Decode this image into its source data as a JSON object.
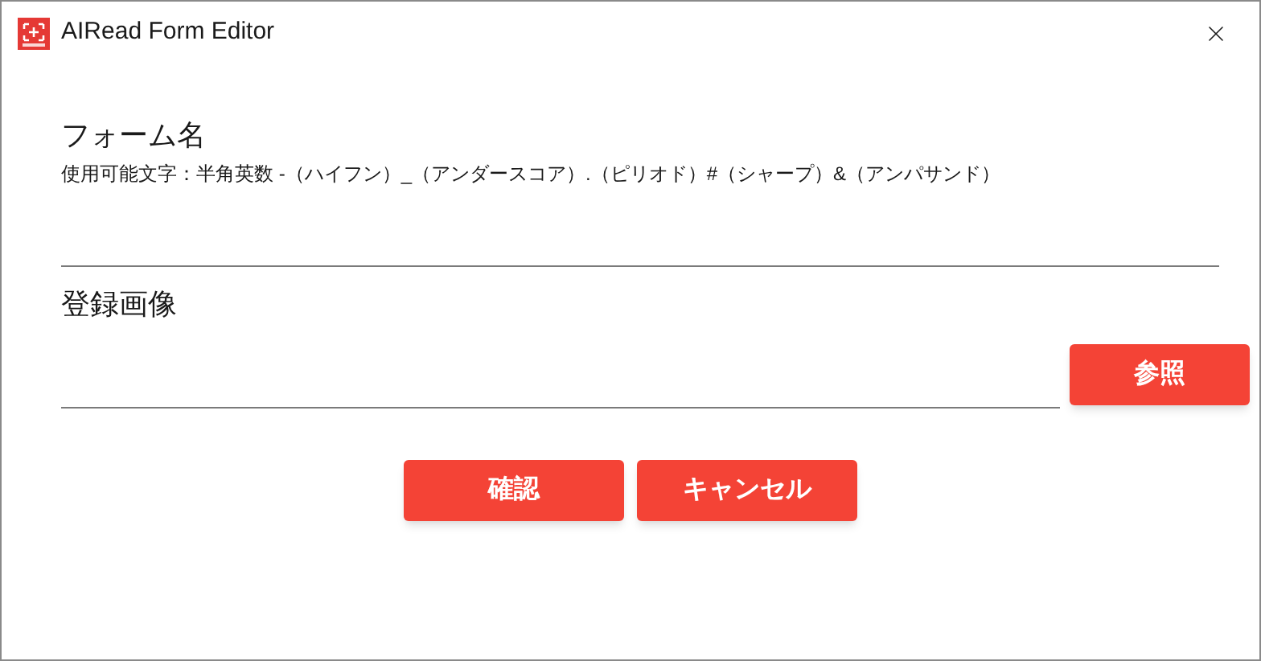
{
  "window": {
    "title": "AIRead Form Editor"
  },
  "form_name": {
    "label": "フォーム名",
    "hint": "使用可能文字：半角英数  -（ハイフン）_（アンダースコア）.（ピリオド）#（シャープ）&（アンパサンド）"
  },
  "image": {
    "label": "登録画像",
    "browse_button": "参照"
  },
  "buttons": [
    "確認",
    "キャンセル"
  ]
}
